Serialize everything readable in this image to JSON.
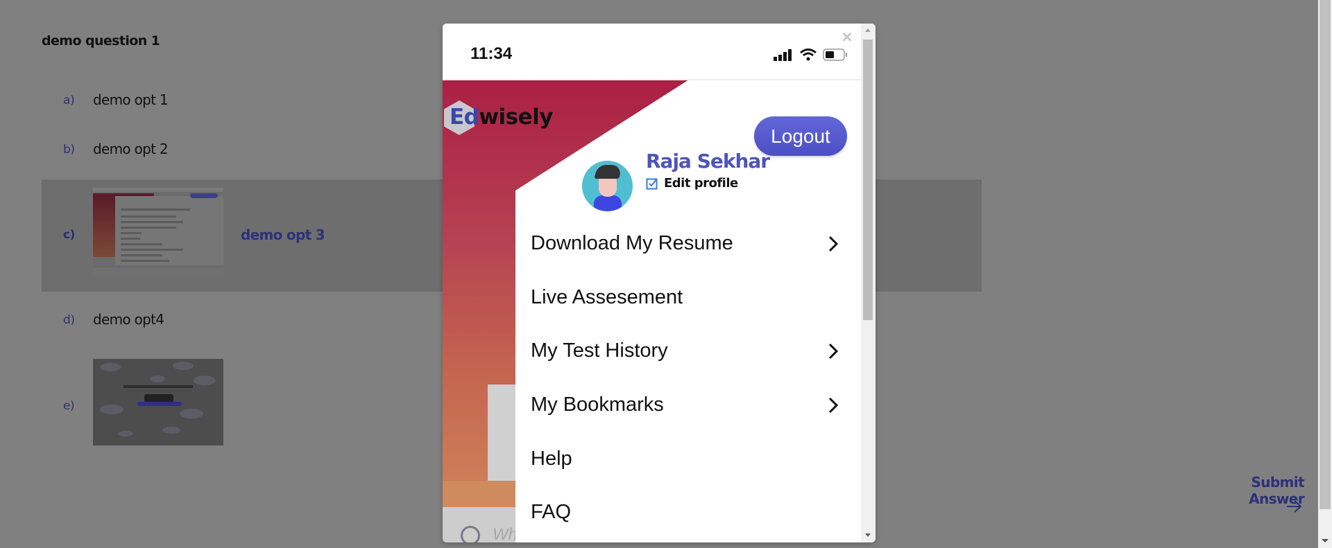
{
  "quiz": {
    "question": "demo question 1",
    "options": [
      {
        "label": "a)",
        "text": "demo opt 1",
        "selected": false
      },
      {
        "label": "b)",
        "text": "demo opt 2",
        "selected": false
      },
      {
        "label": "c)",
        "text": "demo opt 3",
        "selected": true,
        "has_image": true
      },
      {
        "label": "d)",
        "text": "demo opt4",
        "selected": false
      },
      {
        "label": "e)",
        "text": "",
        "selected": false,
        "has_image": true
      }
    ],
    "submit_label": "Submit Answer",
    "submit_icon": "arrow-right-icon"
  },
  "modal": {
    "close_icon": "close-icon",
    "phone": {
      "status_time": "11:34",
      "status_icons": [
        "signal-icon",
        "wifi-icon",
        "battery-icon"
      ],
      "logo": {
        "prefix": "Ed",
        "suffix": "wisely"
      },
      "logout_label": "Logout",
      "profile": {
        "name": "Raja Sekhar",
        "edit_label": "Edit profile"
      },
      "menu": [
        {
          "label": "Download My Resume",
          "chevron": true
        },
        {
          "label": "Live Assesement",
          "chevron": false
        },
        {
          "label": "My Test History",
          "chevron": true
        },
        {
          "label": "My Bookmarks",
          "chevron": true
        },
        {
          "label": "Help",
          "chevron": false
        },
        {
          "label": "FAQ",
          "chevron": false
        }
      ],
      "search_hint": "Wh"
    }
  },
  "colors": {
    "overlay": "#808080",
    "selected_band": "#6e6e6e",
    "accent_text": "#2d3079",
    "logout_button": "#5a5fd8",
    "profile_name": "#4e55b8",
    "brand_red": "#ab1f44",
    "brand_orange": "#d08a5c"
  }
}
